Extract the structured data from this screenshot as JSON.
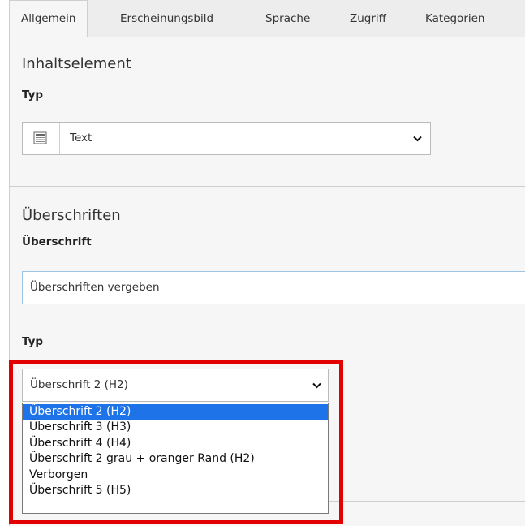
{
  "tabs": [
    "Allgemein",
    "Erscheinungsbild",
    "Sprache",
    "Zugriff",
    "Kategorien"
  ],
  "section1": {
    "title": "Inhaltselement",
    "type_label": "Typ",
    "type_value": "Text"
  },
  "section2": {
    "title": "Überschriften",
    "heading_label": "Überschrift",
    "heading_value": "Überschriften vergeben",
    "type_label": "Typ",
    "type_value": "Überschrift 2 (H2)",
    "options": [
      "Überschrift 2 (H2)",
      "Überschrift 3 (H3)",
      "Überschrift 4 (H4)",
      "Überschrift 2 grau + oranger Rand (H2)",
      "Verborgen",
      "Überschrift 5 (H5)"
    ],
    "selected_option": "Überschrift 2 (H2)"
  },
  "colors": {
    "highlight": "#e30000",
    "option_selected": "#1e73e8"
  }
}
